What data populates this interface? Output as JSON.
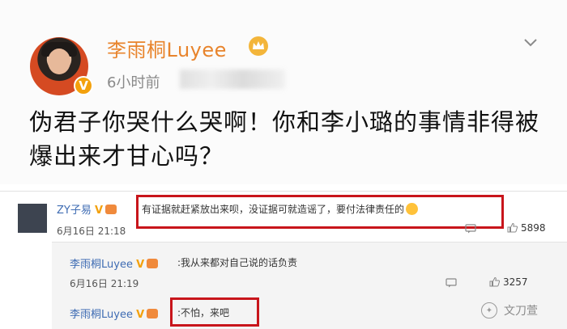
{
  "post": {
    "author": "李雨桐Luyee",
    "verified_badge": "V",
    "time": "6小时前",
    "text": "伪君子你哭什么哭啊！你和李小璐的事情非得被爆出来才甘心吗？",
    "icons": [
      "crown-icon",
      "chevron-down-icon",
      "verified-badge-icon"
    ]
  },
  "comments": [
    {
      "author": "ZY子易",
      "verified_badge": "V",
      "text": "有证据就赶紧放出来呗，没证据可就造谣了，要付法律责任的",
      "date": "6月16日 21:18",
      "likes": "5898",
      "replies": [
        {
          "author": "李雨桐Luyee",
          "verified_badge": "V",
          "text": ":我从来都对自己说的话负责",
          "date": "6月16日 21:19",
          "likes": "3257"
        },
        {
          "author": "李雨桐Luyee",
          "verified_badge": "V",
          "text": ":不怕，来吧"
        }
      ]
    }
  ],
  "watermark": {
    "text": "文刀萱"
  },
  "colors": {
    "name": "#e8842c",
    "link": "#3f6cb3",
    "highlight_box": "#c8151b",
    "badge": "#f3a10d"
  }
}
